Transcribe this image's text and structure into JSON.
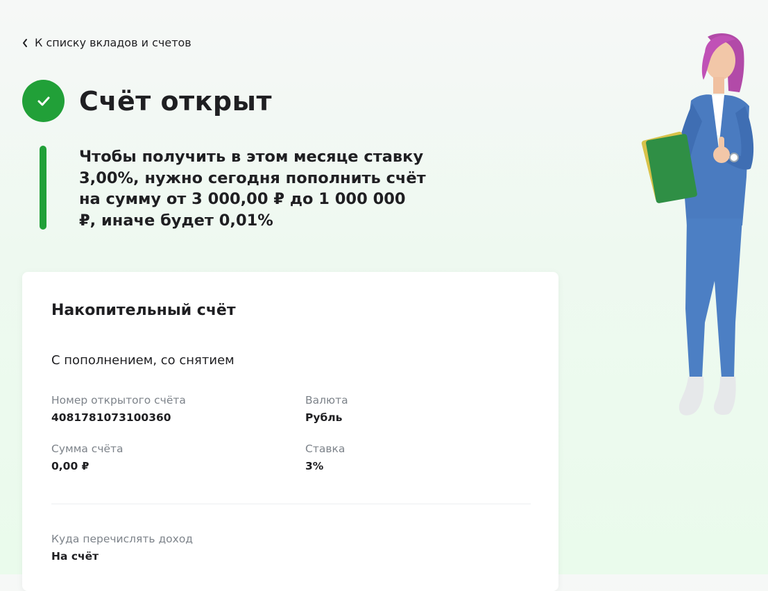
{
  "nav": {
    "back_label": "К списку вкладов и счетов"
  },
  "header": {
    "title": "Счёт открыт"
  },
  "notice": {
    "text": "Чтобы получить в этом месяце ставку 3,00%, нужно сегодня пополнить счёт на сумму от 3 000,00 ₽ до 1 000 000 ₽, иначе будет 0,01%"
  },
  "card": {
    "title": "Накопительный счёт",
    "subtitle": "С пополнением, со снятием",
    "account_number": {
      "label": "Номер открытого счёта",
      "value": "4081781073100360"
    },
    "currency": {
      "label": "Валюта",
      "value": "Рубль"
    },
    "amount": {
      "label": "Сумма счёта",
      "value": "0,00 ₽"
    },
    "rate": {
      "label": "Ставка",
      "value": "3%"
    },
    "income": {
      "label": "Куда перечислять доход",
      "value": "На счёт"
    }
  },
  "colors": {
    "accent": "#21a038",
    "muted_text": "#7d838a"
  }
}
